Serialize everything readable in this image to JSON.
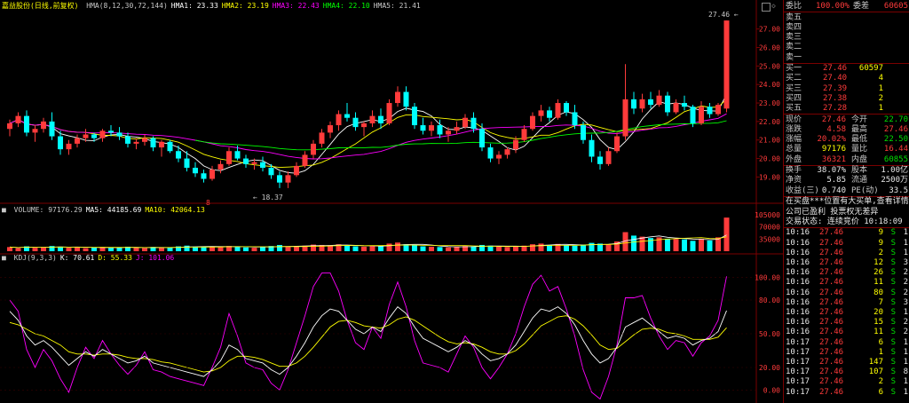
{
  "title": "嘉益股份(日线,前复权)",
  "ma_bar": {
    "series": [
      {
        "label": "HMA(8,12,30,72,144)",
        "color": "#c8c8c8"
      },
      {
        "label": "HMA1: 23.33",
        "color": "#ffffff"
      },
      {
        "label": "HMA2: 23.19",
        "color": "#ffff00"
      },
      {
        "label": "HMA3: 22.43",
        "color": "#ff00ff"
      },
      {
        "label": "HMA4: 22.10",
        "color": "#00ff00"
      },
      {
        "label": "HMA5: 21.41",
        "color": "#c8c8c8"
      }
    ]
  },
  "volume_bar": {
    "series": [
      {
        "label": "VOLUME: 97176.29",
        "color": "#c8c8c8"
      },
      {
        "label": "MA5: 44185.69",
        "color": "#ffffff"
      },
      {
        "label": "MA10: 42064.13",
        "color": "#ffff00"
      }
    ]
  },
  "kdj_bar": {
    "series": [
      {
        "label": "KDJ(9,3,3)",
        "color": "#c8c8c8"
      },
      {
        "label": "K: 70.61",
        "color": "#ffffff"
      },
      {
        "label": "D: 55.33",
        "color": "#ffff00"
      },
      {
        "label": "J: 101.06",
        "color": "#ff00ff"
      }
    ]
  },
  "price_axis": [
    "27.00",
    "26.00",
    "25.00",
    "24.00",
    "23.00",
    "22.00",
    "21.00",
    "20.00",
    "19.00"
  ],
  "volume_axis": [
    "105000",
    "70000",
    "35000"
  ],
  "kdj_axis": [
    "100.00",
    "80.00",
    "50.00",
    "20.00",
    "0.00"
  ],
  "annotations": {
    "high": "27.46",
    "low": "18.37",
    "marker": "8"
  },
  "order_book": {
    "ratio_label": "委比",
    "ratio_value": "100.00%",
    "diff_label": "委差",
    "diff_value": "60605",
    "asks": [
      {
        "label": "卖五",
        "price": "",
        "vol": ""
      },
      {
        "label": "卖四",
        "price": "",
        "vol": ""
      },
      {
        "label": "卖三",
        "price": "",
        "vol": ""
      },
      {
        "label": "卖二",
        "price": "",
        "vol": ""
      },
      {
        "label": "卖一",
        "price": "",
        "vol": ""
      }
    ],
    "bids": [
      {
        "label": "买一",
        "price": "27.46",
        "vol": "60597"
      },
      {
        "label": "买二",
        "price": "27.40",
        "vol": "4"
      },
      {
        "label": "买三",
        "price": "27.39",
        "vol": "1"
      },
      {
        "label": "买四",
        "price": "27.38",
        "vol": "2"
      },
      {
        "label": "买五",
        "price": "27.28",
        "vol": "1"
      }
    ]
  },
  "quote": [
    {
      "l1": "现价",
      "v1": "27.46",
      "c1": "red",
      "l2": "今开",
      "v2": "22.70",
      "c2": "green"
    },
    {
      "l1": "涨跌",
      "v1": "4.58",
      "c1": "red",
      "l2": "最高",
      "v2": "27.46",
      "c2": "red"
    },
    {
      "l1": "涨幅",
      "v1": "20.02%",
      "c1": "red",
      "l2": "最低",
      "v2": "22.50",
      "c2": "green"
    },
    {
      "l1": "总量",
      "v1": "97176",
      "c1": "yellow",
      "l2": "量比",
      "v2": "16.44",
      "c2": "red"
    },
    {
      "l1": "外盘",
      "v1": "36321",
      "c1": "red",
      "l2": "内盘",
      "v2": "60855",
      "c2": "green"
    }
  ],
  "stats": [
    {
      "l1": "换手",
      "v1": "38.07%",
      "l2": "股本",
      "v2": "1.00亿"
    },
    {
      "l1": "净资",
      "v1": "5.85",
      "l2": "流通",
      "v2": "2500万"
    },
    {
      "l1": "收益(三)",
      "v1": "0.740",
      "l2": "PE(动)",
      "v2": "33.5"
    }
  ],
  "notices": [
    "在买盘***位置有大买单,查看详情",
    "公司已盈利 投票权无差异",
    "交易状态: 连续竞价 10:18:09"
  ],
  "ticks": [
    {
      "time": "10:16",
      "price": "27.46",
      "vol": "9",
      "side": "S",
      "n": "1"
    },
    {
      "time": "10:16",
      "price": "27.46",
      "vol": "9",
      "side": "S",
      "n": "1"
    },
    {
      "time": "10:16",
      "price": "27.46",
      "vol": "2",
      "side": "S",
      "n": "1"
    },
    {
      "time": "10:16",
      "price": "27.46",
      "vol": "12",
      "side": "S",
      "n": "3"
    },
    {
      "time": "10:16",
      "price": "27.46",
      "vol": "26",
      "side": "S",
      "n": "2"
    },
    {
      "time": "10:16",
      "price": "27.46",
      "vol": "11",
      "side": "S",
      "n": "2"
    },
    {
      "time": "10:16",
      "price": "27.46",
      "vol": "80",
      "side": "S",
      "n": "2"
    },
    {
      "time": "10:16",
      "price": "27.46",
      "vol": "7",
      "side": "S",
      "n": "3"
    },
    {
      "time": "10:16",
      "price": "27.46",
      "vol": "20",
      "side": "S",
      "n": "1"
    },
    {
      "time": "10:16",
      "price": "27.46",
      "vol": "15",
      "side": "S",
      "n": "2"
    },
    {
      "time": "10:16",
      "price": "27.46",
      "vol": "11",
      "side": "S",
      "n": "2"
    },
    {
      "time": "10:17",
      "price": "27.46",
      "vol": "6",
      "side": "S",
      "n": "1"
    },
    {
      "time": "10:17",
      "price": "27.46",
      "vol": "1",
      "side": "S",
      "n": "1"
    },
    {
      "time": "10:17",
      "price": "27.46",
      "vol": "147",
      "side": "S",
      "n": "1"
    },
    {
      "time": "10:17",
      "price": "27.46",
      "vol": "107",
      "side": "S",
      "n": "8"
    },
    {
      "time": "10:17",
      "price": "27.46",
      "vol": "2",
      "side": "S",
      "n": "1"
    },
    {
      "time": "10:17",
      "price": "27.46",
      "vol": "6",
      "side": "S",
      "n": "1"
    }
  ],
  "colors": {
    "up": "#ff3b3b",
    "down": "#00ffff",
    "grid": "#7a0000",
    "ma1": "#ffffff",
    "ma2": "#ffff00",
    "ma3": "#ff00ff",
    "ma4": "#00ff00"
  },
  "chart_data": {
    "type": "candlestick",
    "price_range": [
      18.3,
      27.8
    ],
    "candles": [
      [
        21.6,
        22.1,
        21.2,
        21.9
      ],
      [
        21.9,
        22.5,
        21.7,
        22.3
      ],
      [
        22.3,
        22.6,
        21.2,
        21.4
      ],
      [
        21.4,
        21.8,
        20.9,
        21.6
      ],
      [
        21.6,
        22.2,
        21.4,
        22.0
      ],
      [
        22.0,
        22.5,
        21.0,
        21.2
      ],
      [
        21.2,
        21.5,
        20.2,
        20.5
      ],
      [
        20.5,
        21.0,
        20.2,
        20.8
      ],
      [
        20.8,
        21.3,
        20.6,
        21.1
      ],
      [
        21.1,
        21.6,
        20.9,
        21.3
      ],
      [
        21.3,
        21.4,
        20.9,
        21.1
      ],
      [
        21.1,
        21.6,
        20.9,
        21.5
      ],
      [
        21.5,
        21.8,
        21.2,
        21.4
      ],
      [
        21.4,
        21.7,
        21.0,
        21.2
      ],
      [
        21.2,
        21.4,
        20.6,
        20.8
      ],
      [
        20.8,
        21.1,
        20.5,
        20.9
      ],
      [
        20.9,
        21.3,
        20.7,
        21.1
      ],
      [
        21.1,
        21.2,
        20.4,
        20.6
      ],
      [
        20.6,
        21.0,
        20.1,
        20.9
      ],
      [
        20.9,
        21.0,
        20.3,
        20.4
      ],
      [
        20.4,
        20.7,
        19.8,
        20.0
      ],
      [
        20.0,
        20.4,
        19.3,
        19.5
      ],
      [
        19.5,
        19.8,
        19.0,
        19.2
      ],
      [
        19.2,
        19.4,
        18.7,
        18.9
      ],
      [
        18.9,
        19.6,
        18.8,
        19.4
      ],
      [
        19.4,
        19.9,
        19.2,
        19.7
      ],
      [
        19.7,
        20.6,
        19.6,
        20.4
      ],
      [
        20.4,
        20.7,
        19.9,
        20.0
      ],
      [
        20.0,
        20.2,
        19.5,
        19.7
      ],
      [
        19.7,
        20.0,
        19.4,
        19.8
      ],
      [
        19.8,
        20.1,
        19.3,
        19.5
      ],
      [
        19.5,
        19.7,
        18.9,
        19.1
      ],
      [
        19.1,
        19.3,
        18.4,
        18.7
      ],
      [
        18.7,
        19.3,
        18.4,
        19.1
      ],
      [
        19.1,
        19.8,
        19.0,
        19.6
      ],
      [
        19.6,
        20.4,
        19.5,
        20.2
      ],
      [
        20.2,
        21.0,
        20.0,
        20.8
      ],
      [
        20.8,
        21.6,
        20.6,
        21.4
      ],
      [
        21.4,
        22.0,
        21.1,
        21.8
      ],
      [
        21.8,
        22.6,
        21.5,
        22.4
      ],
      [
        22.4,
        23.0,
        22.0,
        22.2
      ],
      [
        22.2,
        22.5,
        21.5,
        21.7
      ],
      [
        21.7,
        22.0,
        21.2,
        21.9
      ],
      [
        21.9,
        22.6,
        21.7,
        22.3
      ],
      [
        22.3,
        22.7,
        21.6,
        21.9
      ],
      [
        21.9,
        23.2,
        21.8,
        23.0
      ],
      [
        23.0,
        23.9,
        22.8,
        23.6
      ],
      [
        23.6,
        23.9,
        22.6,
        22.8
      ],
      [
        22.8,
        23.0,
        21.6,
        21.8
      ],
      [
        21.8,
        22.2,
        21.3,
        21.5
      ],
      [
        21.5,
        22.0,
        21.2,
        21.8
      ],
      [
        21.8,
        22.1,
        21.1,
        21.3
      ],
      [
        21.3,
        21.7,
        20.9,
        21.5
      ],
      [
        21.5,
        22.0,
        21.3,
        21.7
      ],
      [
        21.7,
        22.4,
        21.6,
        22.2
      ],
      [
        22.2,
        22.5,
        21.4,
        21.6
      ],
      [
        21.6,
        21.9,
        20.4,
        20.6
      ],
      [
        20.6,
        20.8,
        19.8,
        20.0
      ],
      [
        20.0,
        20.4,
        19.7,
        20.2
      ],
      [
        20.2,
        20.6,
        20.0,
        20.5
      ],
      [
        20.5,
        21.2,
        20.3,
        21.0
      ],
      [
        21.0,
        21.8,
        20.9,
        21.6
      ],
      [
        21.6,
        22.5,
        21.5,
        22.3
      ],
      [
        22.3,
        22.9,
        22.0,
        22.6
      ],
      [
        22.6,
        22.8,
        22.0,
        22.2
      ],
      [
        22.2,
        23.2,
        22.1,
        23.0
      ],
      [
        23.0,
        23.1,
        22.3,
        22.5
      ],
      [
        22.5,
        22.9,
        21.6,
        21.8
      ],
      [
        21.8,
        22.0,
        20.8,
        21.0
      ],
      [
        21.0,
        21.3,
        19.8,
        20.1
      ],
      [
        20.1,
        20.4,
        19.4,
        19.7
      ],
      [
        19.7,
        20.6,
        19.6,
        20.4
      ],
      [
        20.4,
        21.4,
        20.3,
        21.2
      ],
      [
        21.2,
        25.1,
        21.0,
        23.2
      ],
      [
        23.2,
        23.6,
        22.4,
        22.7
      ],
      [
        22.7,
        23.5,
        22.5,
        23.2
      ],
      [
        23.2,
        23.6,
        22.7,
        22.9
      ],
      [
        22.9,
        23.7,
        22.8,
        23.4
      ],
      [
        23.4,
        23.6,
        22.3,
        22.5
      ],
      [
        22.5,
        23.2,
        22.4,
        23.0
      ],
      [
        23.0,
        23.4,
        22.6,
        22.8
      ],
      [
        22.8,
        22.9,
        21.7,
        21.9
      ],
      [
        21.9,
        23.1,
        21.8,
        22.8
      ],
      [
        22.8,
        23.0,
        22.2,
        22.4
      ],
      [
        22.4,
        23.0,
        22.3,
        22.9
      ],
      [
        22.7,
        27.46,
        22.5,
        27.46
      ]
    ],
    "volume": [
      12,
      9,
      14,
      10,
      11,
      15,
      13,
      10,
      11,
      9,
      10,
      12,
      9,
      11,
      13,
      10,
      9,
      12,
      10,
      11,
      14,
      16,
      13,
      12,
      14,
      12,
      15,
      13,
      11,
      10,
      12,
      15,
      18,
      14,
      13,
      16,
      19,
      18,
      17,
      20,
      16,
      14,
      13,
      15,
      14,
      22,
      25,
      20,
      17,
      14,
      13,
      12,
      11,
      13,
      15,
      14,
      18,
      16,
      13,
      12,
      14,
      16,
      20,
      22,
      18,
      21,
      17,
      16,
      18,
      24,
      22,
      20,
      28,
      55,
      45,
      42,
      38,
      40,
      36,
      35,
      34,
      30,
      36,
      31,
      40,
      97
    ],
    "kdj": {
      "k": [
        70,
        62,
        48,
        40,
        44,
        38,
        30,
        22,
        28,
        34,
        30,
        36,
        32,
        28,
        24,
        26,
        30,
        24,
        22,
        20,
        18,
        16,
        14,
        12,
        18,
        26,
        40,
        36,
        28,
        26,
        24,
        18,
        14,
        20,
        30,
        42,
        56,
        66,
        72,
        70,
        62,
        54,
        50,
        56,
        52,
        64,
        74,
        68,
        56,
        46,
        42,
        38,
        34,
        38,
        44,
        40,
        32,
        26,
        28,
        32,
        40,
        52,
        64,
        72,
        70,
        74,
        68,
        58,
        44,
        32,
        24,
        28,
        38,
        56,
        60,
        64,
        58,
        52,
        46,
        48,
        46,
        40,
        44,
        46,
        52,
        70.61
      ],
      "d": [
        60,
        58,
        54,
        50,
        48,
        44,
        40,
        34,
        32,
        32,
        31,
        32,
        32,
        31,
        29,
        28,
        28,
        27,
        25,
        24,
        22,
        20,
        18,
        16,
        17,
        20,
        26,
        30,
        30,
        29,
        27,
        24,
        21,
        21,
        24,
        30,
        38,
        47,
        56,
        61,
        62,
        60,
        57,
        56,
        55,
        58,
        63,
        65,
        62,
        57,
        52,
        47,
        43,
        41,
        42,
        41,
        38,
        34,
        32,
        32,
        35,
        41,
        49,
        57,
        61,
        65,
        66,
        63,
        57,
        49,
        40,
        36,
        37,
        43,
        49,
        54,
        55,
        54,
        51,
        50,
        48,
        45,
        45,
        45,
        47,
        55.33
      ],
      "j": [
        80,
        70,
        36,
        20,
        36,
        26,
        10,
        -2,
        20,
        38,
        28,
        44,
        32,
        22,
        14,
        22,
        34,
        18,
        16,
        12,
        10,
        8,
        6,
        4,
        20,
        38,
        68,
        48,
        24,
        20,
        18,
        6,
        0,
        18,
        42,
        66,
        92,
        104,
        104,
        88,
        62,
        42,
        36,
        56,
        46,
        76,
        96,
        74,
        44,
        24,
        22,
        20,
        16,
        32,
        48,
        38,
        20,
        10,
        20,
        32,
        50,
        74,
        94,
        102,
        88,
        92,
        72,
        48,
        18,
        -2,
        -8,
        12,
        40,
        82,
        82,
        84,
        64,
        48,
        36,
        44,
        42,
        30,
        42,
        48,
        62,
        101.06
      ]
    }
  }
}
